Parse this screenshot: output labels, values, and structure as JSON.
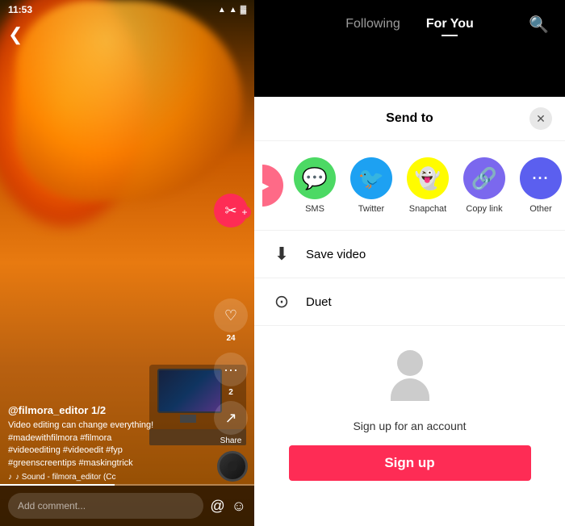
{
  "status": {
    "time": "11:53",
    "icons": "▲ ▲ ▲"
  },
  "nav": {
    "following_label": "Following",
    "for_you_label": "For You",
    "active_tab": "for_you"
  },
  "video": {
    "username": "@filmora_editor  1/2",
    "description": "Video editing can change everything!\n#madewithfilmora #filmora\n#videoediting #videoedit #fyp\n#greenscreentips #maskingtrick",
    "music": "♪ Sound - filmora_editor (Cc",
    "action_buttons": {
      "heart_count": "24",
      "comment_count": "2",
      "share_label": "Share"
    },
    "comment_placeholder": "Add comment..."
  },
  "send_to_sheet": {
    "title": "Send to",
    "close_icon": "✕",
    "apps": [
      {
        "label": "SMS",
        "color": "#4CD964",
        "icon": "💬"
      },
      {
        "label": "Twitter",
        "color": "#1DA1F2",
        "icon": "🐦"
      },
      {
        "label": "Snapchat",
        "color": "#FFFC00",
        "icon": "👻",
        "text_color": "#333"
      },
      {
        "label": "Copy link",
        "color": "#7B68EE",
        "icon": "🔗"
      },
      {
        "label": "Other",
        "color": "#5B5FEF",
        "icon": "···"
      }
    ],
    "save_video_label": "Save video",
    "duet_label": "Duet",
    "signup_prompt": "Sign up for an account",
    "signup_button": "Sign up"
  }
}
